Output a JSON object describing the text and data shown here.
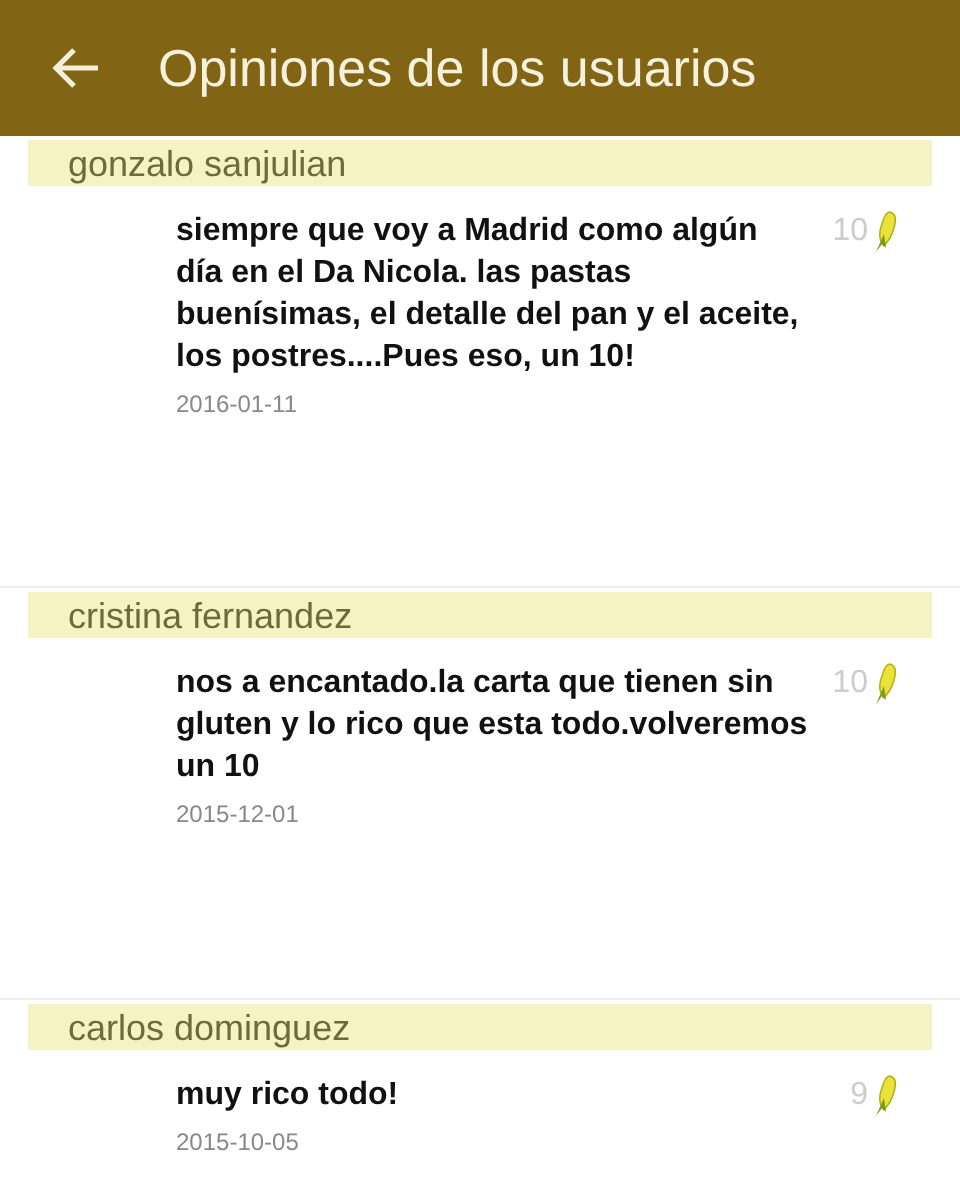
{
  "app_bar": {
    "title": "Opiniones de los usuarios"
  },
  "reviews": [
    {
      "user": "gonzalo sanjulian",
      "text": "siempre que voy a Madrid como algún día en el Da Nicola. las pastas buenísimas, el detalle del pan y el aceite, los postres....Pues eso, un 10!",
      "date": "2016-01-11",
      "score": "10"
    },
    {
      "user": "cristina fernandez",
      "text": "nos a encantado.la carta que tienen sin gluten y lo rico que esta todo.volveremos un 10",
      "date": "2015-12-01",
      "score": "10"
    },
    {
      "user": "carlos dominguez",
      "text": "muy rico todo!",
      "date": "2015-10-05",
      "score": "9"
    }
  ]
}
